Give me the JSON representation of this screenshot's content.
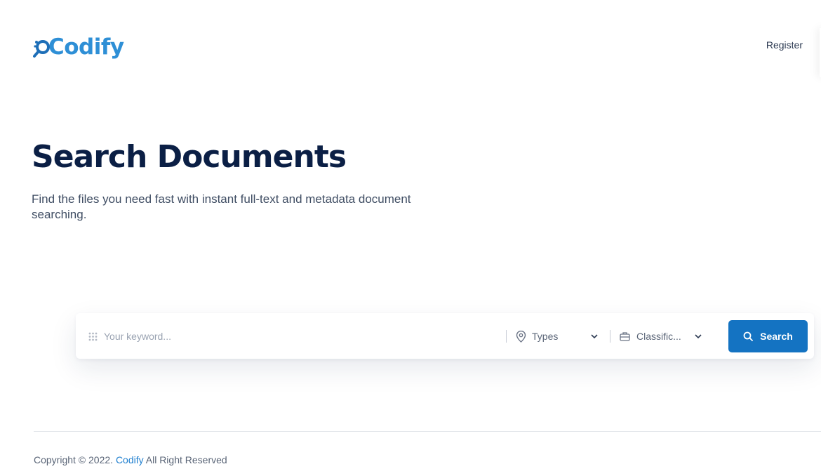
{
  "header": {
    "logo_text": "Codify",
    "register_label": "Register"
  },
  "hero": {
    "title": "Search Documents",
    "subtitle": "Find the files you need fast with instant full-text and metadata document searching."
  },
  "search": {
    "keyword_placeholder": "Your keyword...",
    "types_label": "Types",
    "classification_label": "Classific...",
    "button_label": "Search"
  },
  "footer": {
    "copyright_prefix": "Copyright © 2022.",
    "brand": "Codify",
    "copyright_suffix": "All Right Reserved"
  },
  "icons": {
    "logo": "magnifier-logo-icon",
    "keyword": "grid-dots-icon",
    "types": "map-pin-icon",
    "classification": "briefcase-icon",
    "dropdown": "chevron-down-icon",
    "search": "search-icon"
  },
  "colors": {
    "brand": "#2e8fd6",
    "button": "#1473c2",
    "title": "#0b1f45"
  }
}
